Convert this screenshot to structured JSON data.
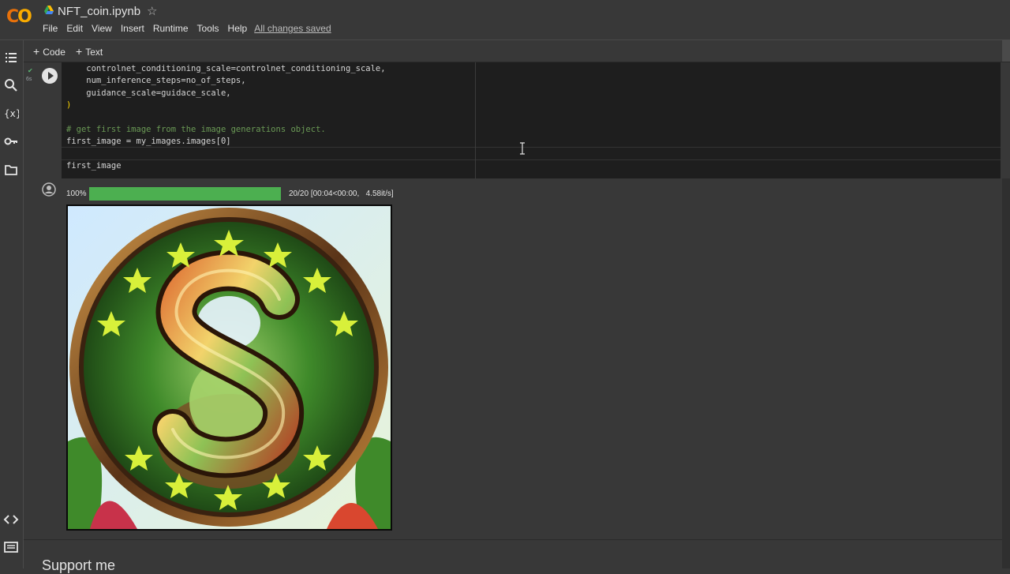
{
  "header": {
    "logo": "CO",
    "notebook_title": "NFT_coin.ipynb",
    "menu": [
      "File",
      "Edit",
      "View",
      "Insert",
      "Runtime",
      "Tools",
      "Help"
    ],
    "save_status": "All changes saved"
  },
  "toolbar": {
    "code_label": "Code",
    "text_label": "Text"
  },
  "cell": {
    "exec_time": "6s",
    "code_lines": [
      "    controlnet_conditioning_scale=controlnet_conditioning_scale,",
      "    num_inference_steps=no_of_steps,",
      "    guidance_scale=guidace_scale,",
      ")",
      "",
      "# get first image from the image generations object.",
      "first_image = my_images.images[0]",
      "",
      "first_image"
    ]
  },
  "output": {
    "progress_percent_label": "100%",
    "progress_fraction": 1.0,
    "progress_steps": "20/20",
    "progress_time": "[00:04<00:00,",
    "progress_rate": "4.58it/s]",
    "progress_color": "#4caf50"
  },
  "section": {
    "heading": "Support me"
  },
  "icons": {
    "rail": [
      "toc-icon",
      "search-icon",
      "variables-icon",
      "key-icon",
      "folder-icon",
      "code-snippets-icon",
      "terminal-icon"
    ]
  },
  "colors": {
    "brand_orange": "#f9ab00",
    "background": "#383838",
    "code_bg": "#1e1e1e"
  }
}
